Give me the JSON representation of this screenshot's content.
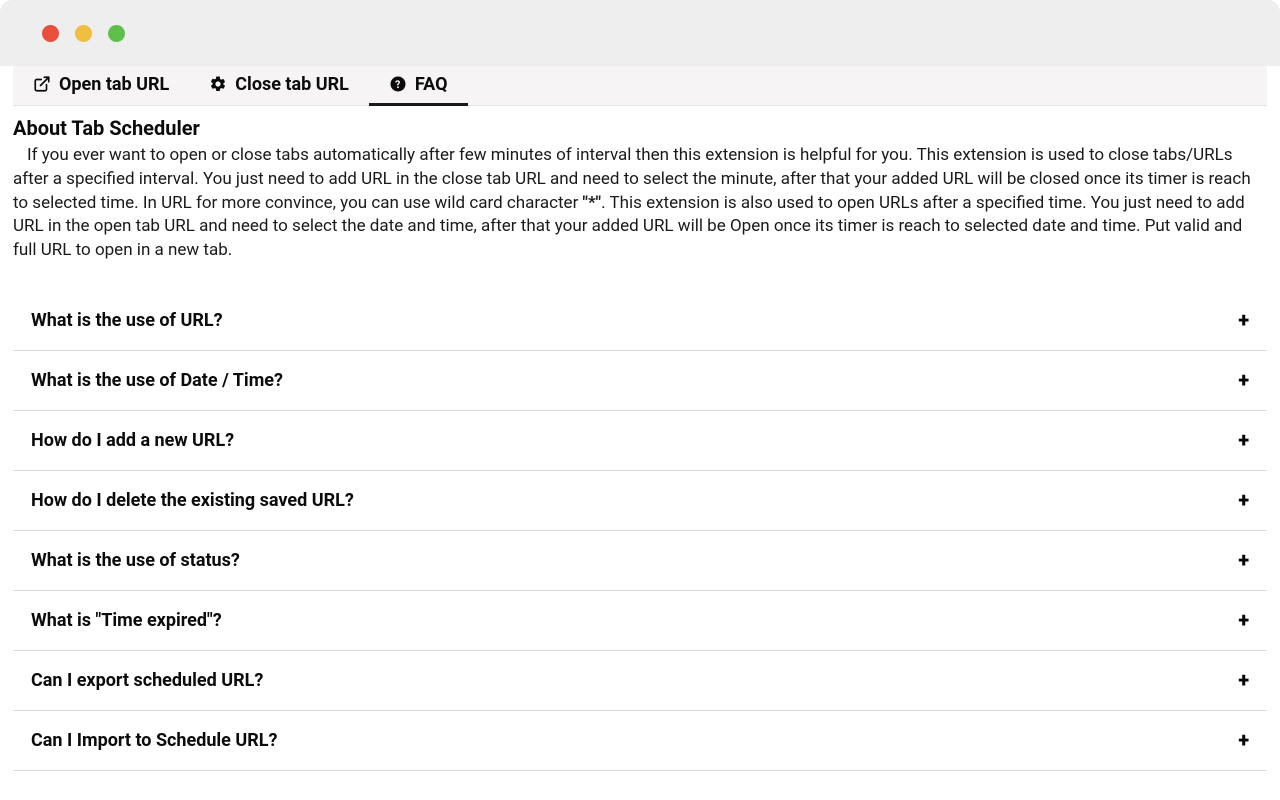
{
  "tabs": [
    {
      "label": "Open tab URL"
    },
    {
      "label": "Close tab URL"
    },
    {
      "label": "FAQ"
    }
  ],
  "about": {
    "title": "About Tab Scheduler",
    "part1": "If you ever want to open or close tabs automatically after few minutes of interval then this extension is helpful for you. This extension is used to close tabs/URLs after a specified interval. You just need to add URL in the close tab URL and need to select the minute, after that your added URL will be closed once its timer is reach to selected time. In URL for more convince, you can use wild card character ",
    "wild": "\"*\"",
    "part2": ". This extension is also used to open URLs after a specified time. You just need to add URL in the open tab URL and need to select the date and time, after that your added URL will be Open once its timer is reach to selected date and time. Put valid and full URL to open in a new tab."
  },
  "faq": [
    {
      "q": "What is the use of URL?"
    },
    {
      "q": "What is the use of Date / Time?"
    },
    {
      "q": "How do I add a new URL?"
    },
    {
      "q": "How do I delete the existing saved URL?"
    },
    {
      "q": "What is the use of status?"
    },
    {
      "q": "What is \"Time expired\"?"
    },
    {
      "q": "Can I export scheduled URL?"
    },
    {
      "q": "Can I Import to Schedule URL?"
    }
  ],
  "icons": {
    "plus": "+"
  }
}
